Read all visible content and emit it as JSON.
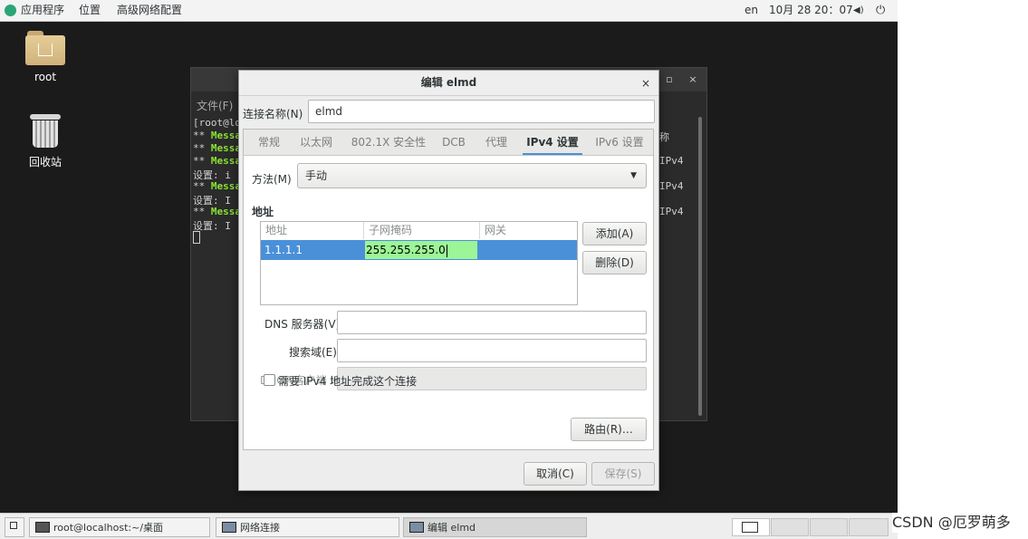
{
  "topbar": {
    "applications": "应用程序",
    "places": "位置",
    "app_name": "高级网络配置",
    "lang": "en",
    "datetime": "10月 28 20：07",
    "volume_icon": "◀)",
    "power_icon": "⏻"
  },
  "desktop": {
    "home_label": "root",
    "trash_label": "回收站"
  },
  "terminal": {
    "menu": "文件(F)",
    "lines": [
      {
        "pre": "[root@lo",
        "msg": ""
      },
      {
        "pre": "** ",
        "msg": "Messa"
      },
      {
        "pre": "** ",
        "msg": "Messa"
      },
      {
        "pre": "** ",
        "msg": "Messa"
      },
      {
        "pre": "设置: i",
        "msg": ""
      },
      {
        "pre": "** ",
        "msg": "Messa"
      },
      {
        "pre": "设置: I",
        "msg": ""
      },
      {
        "pre": "** ",
        "msg": "Messa"
      },
      {
        "pre": "设置: I",
        "msg": ""
      }
    ],
    "right_fragments": [
      "称",
      "IPv4",
      "IPv4",
      "IPv4"
    ],
    "ctl_min": "▫",
    "ctl_close": "×"
  },
  "dialog": {
    "title": "编辑 elmd",
    "close": "×",
    "conn_name_label": "连接名称(N)",
    "conn_name_value": "elmd",
    "tabs": [
      "常规",
      "以太网",
      "802.1X 安全性",
      "DCB",
      "代理",
      "IPv4 设置",
      "IPv6 设置"
    ],
    "active_tab": "IPv4 设置",
    "method_label": "方法(M)",
    "method_value": "手动",
    "addresses_heading": "地址",
    "table": {
      "headers": [
        "地址",
        "子网掩码",
        "网关"
      ],
      "row": {
        "address": "1.1.1.1",
        "netmask": "255.255.255.0",
        "gateway": ""
      }
    },
    "add_button": "添加(A)",
    "delete_button": "删除(D)",
    "dns_label": "DNS 服务器(V)",
    "dns_value": "",
    "search_label": "搜索域(E)",
    "search_value": "",
    "dhcp_label": "DHCP 客户端 ID",
    "dhcp_value": "",
    "require_ipv4_label": "需要 IPv4 地址完成这个连接",
    "routes_button": "路由(R)…",
    "cancel_button": "取消(C)",
    "save_button": "保存(S)"
  },
  "taskbar": {
    "terminal_task": "root@localhost:~/桌面",
    "network_task": "网络连接",
    "edit_task": "编辑 elmd"
  },
  "watermark": "CSDN @厄罗萌多"
}
